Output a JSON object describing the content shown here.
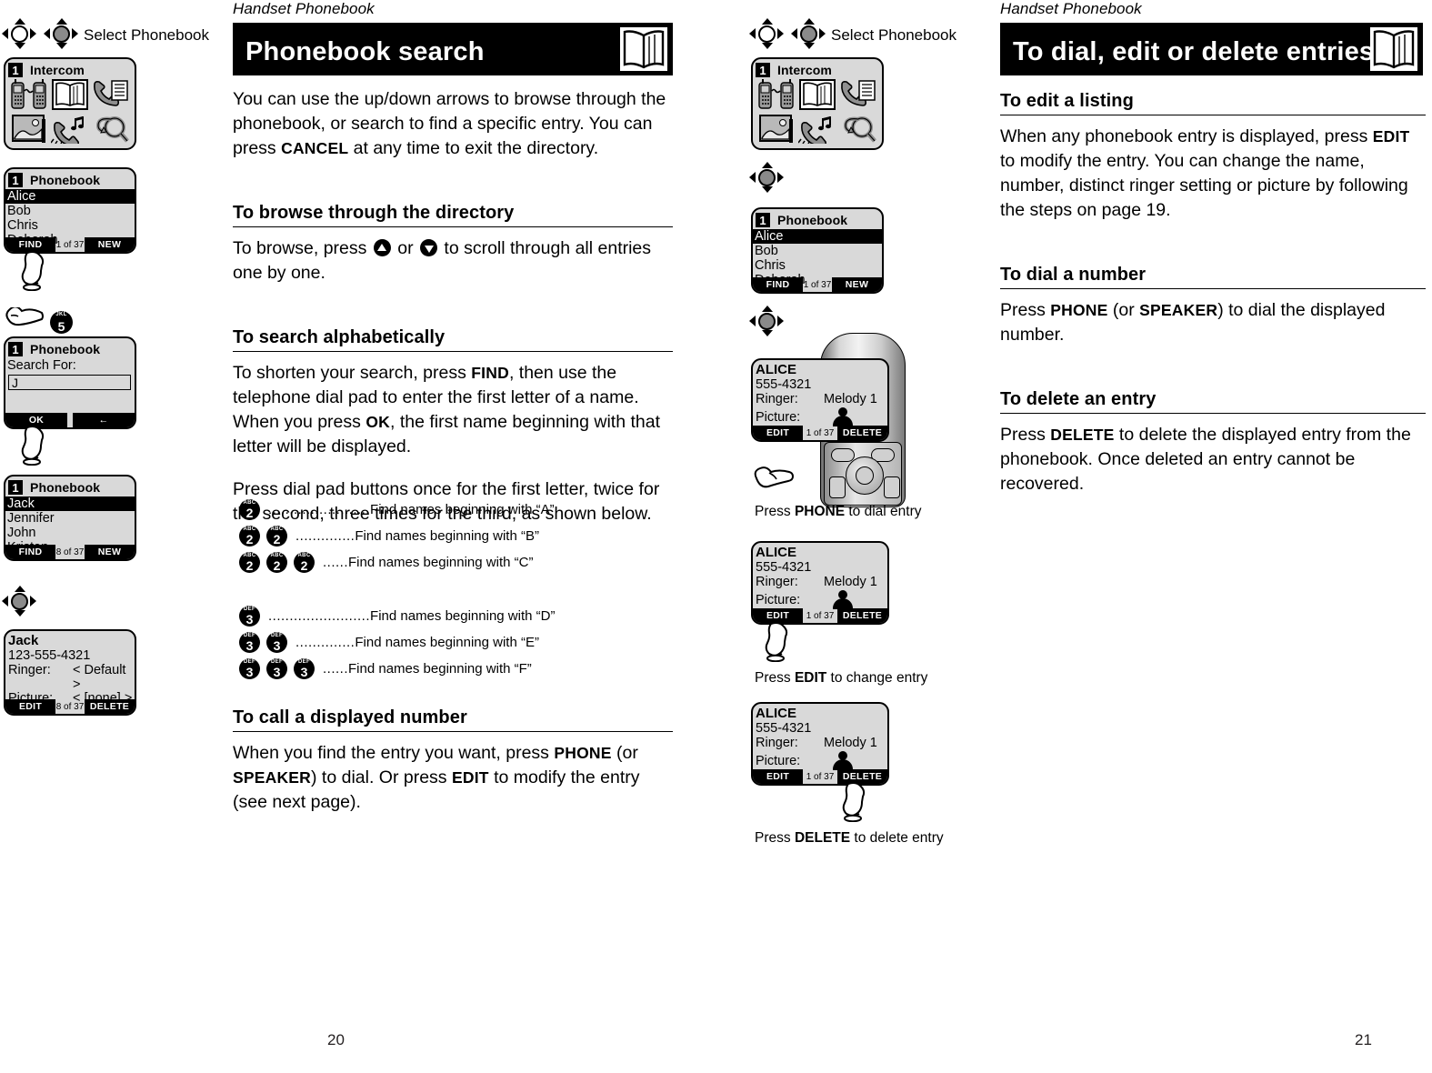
{
  "meta": {
    "left_page_number": "20",
    "right_page_number": "21"
  },
  "left_page": {
    "running_head": "Handset Phonebook",
    "title": "Phonebook search",
    "title_icon": "open-book-icon",
    "intro": {
      "pre1": "You can use the up/down arrows to browse through the phonebook, or search to find a specific entry. You can press ",
      "bold1": "CANCEL",
      "post1": " at any time to exit the directory."
    },
    "section_browse": {
      "heading": "To browse through the directory",
      "pre": "To browse, press ",
      "mid": " or ",
      "post": " to scroll through all entries one by one."
    },
    "section_alpha": {
      "heading": "To search alphabetically",
      "p1_a": "To shorten your search, press ",
      "p1_b": "FIND",
      "p1_c": ", then use the telephone dial pad to enter the first letter of a name. When you press ",
      "p1_d": "OK",
      "p1_e": ", the first name beginning with that letter will be displayed.",
      "p2": "Press dial pad buttons once for the first letter, twice for the second, three times for the third, as shown below."
    },
    "keyrows": [
      {
        "keys": [
          {
            "letters": "ABC",
            "number": "2"
          }
        ],
        "dots": "........................",
        "desc": "Find names beginning with “A”"
      },
      {
        "keys": [
          {
            "letters": "ABC",
            "number": "2"
          },
          {
            "letters": "ABC",
            "number": "2"
          }
        ],
        "dots": "..............",
        "desc": "Find names beginning with “B”"
      },
      {
        "keys": [
          {
            "letters": "ABC",
            "number": "2"
          },
          {
            "letters": "ABC",
            "number": "2"
          },
          {
            "letters": "ABC",
            "number": "2"
          }
        ],
        "dots": "......",
        "desc": "Find names beginning with “C”"
      },
      {
        "keys": [
          {
            "letters": "DEF",
            "number": "3"
          }
        ],
        "dots": "........................",
        "desc": "Find names beginning with “D”"
      },
      {
        "keys": [
          {
            "letters": "DEF",
            "number": "3"
          },
          {
            "letters": "DEF",
            "number": "3"
          }
        ],
        "dots": "..............",
        "desc": "Find names beginning with “E”"
      },
      {
        "keys": [
          {
            "letters": "DEF",
            "number": "3"
          },
          {
            "letters": "DEF",
            "number": "3"
          },
          {
            "letters": "DEF",
            "number": "3"
          }
        ],
        "dots": "......",
        "desc": "Find names beginning with “F”"
      }
    ],
    "section_call": {
      "heading": "To call a displayed number",
      "p_a": "When you find the entry you want, press ",
      "p_b": "PHONE",
      "p_c": " (or ",
      "p_d": "SPEAKER",
      "p_e": ") to dial. Or press ",
      "p_f": "EDIT",
      "p_g": " to modify the entry (see next page)."
    }
  },
  "left_sidebar": {
    "nav_label": "Select Phonebook",
    "screen_intercom": {
      "slot": "1",
      "title": "Intercom",
      "icons": [
        "intercom-handsets-icon",
        "phonebook-book-icon",
        "call-log-icon",
        "picture-frame-icon",
        "ringer-melody-icon",
        "search-magnifier-icon"
      ],
      "selected_icon": "phonebook-book-icon"
    },
    "screen_list_1": {
      "slot": "1",
      "title": "Phonebook",
      "entries": [
        "Alice",
        "Bob",
        "Chris",
        "Deborah"
      ],
      "selected": "Alice",
      "soft_left": "FIND",
      "counter": "1 of 37",
      "soft_right": "NEW"
    },
    "key_five": {
      "letters": "JKL",
      "number": "5"
    },
    "screen_search": {
      "slot": "1",
      "title": "Phonebook",
      "label": "Search For:",
      "value": "J",
      "soft_left": "OK",
      "soft_right": "←"
    },
    "screen_list_2": {
      "slot": "1",
      "title": "Phonebook",
      "entries": [
        "Jack",
        "Jennifer",
        "John",
        "Kristen"
      ],
      "selected": "Jack",
      "soft_left": "FIND",
      "counter": "8 of 37",
      "soft_right": "NEW"
    },
    "screen_detail_jack": {
      "name": "Jack",
      "number": "123-555-4321",
      "ringer_label": "Ringer:",
      "ringer_value": "< Default >",
      "picture_label": "Picture:",
      "picture_value": "< [none] >",
      "soft_left": "EDIT",
      "counter": "8 of 37",
      "soft_right": "DELETE"
    }
  },
  "right_sidebar": {
    "nav_label": "Select Phonebook",
    "screen_intercom": {
      "slot": "1",
      "title": "Intercom",
      "icons": [
        "intercom-handsets-icon",
        "phonebook-book-icon",
        "call-log-icon",
        "picture-frame-icon",
        "ringer-melody-icon",
        "search-magnifier-icon"
      ],
      "selected_icon": "phonebook-book-icon"
    },
    "screen_list": {
      "slot": "1",
      "title": "Phonebook",
      "entries": [
        "Alice",
        "Bob",
        "Chris",
        "Deborah"
      ],
      "selected": "Alice",
      "soft_left": "FIND",
      "counter": "1 of 37",
      "soft_right": "NEW"
    },
    "screen_alice_dial": {
      "name": "ALICE",
      "number": "555-4321",
      "ringer_label": "Ringer:",
      "ringer_value": "Melody 1",
      "picture_label": "Picture:",
      "soft_left": "EDIT",
      "counter": "1 of 37",
      "soft_right": "DELETE"
    },
    "caption_dial_a": "Press ",
    "caption_dial_b": "PHONE",
    "caption_dial_c": " to dial entry",
    "screen_alice_edit": {
      "name": "ALICE",
      "number": "555-4321",
      "ringer_label": "Ringer:",
      "ringer_value": "Melody 1",
      "picture_label": "Picture:",
      "soft_left": "EDIT",
      "counter": "1 of 37",
      "soft_right": "DELETE"
    },
    "caption_edit_a": "Press ",
    "caption_edit_b": "EDIT",
    "caption_edit_c": " to change entry",
    "screen_alice_delete": {
      "name": "ALICE",
      "number": "555-4321",
      "ringer_label": "Ringer:",
      "ringer_value": "Melody 1",
      "picture_label": "Picture:",
      "soft_left": "EDIT",
      "counter": "1 of 37",
      "soft_right": "DELETE"
    },
    "caption_del_a": "Press ",
    "caption_del_b": "DELETE",
    "caption_del_c": " to delete entry"
  },
  "right_page": {
    "running_head": "Handset Phonebook",
    "title": "To dial, edit or delete entries",
    "title_icon": "open-book-icon",
    "section_edit": {
      "heading": "To edit a listing",
      "p_a": "When any phonebook entry is displayed, press ",
      "p_b": "EDIT",
      "p_c": " to modify the entry. You can change the name, number, distinct ringer setting or picture by following the steps on page 19."
    },
    "section_dial": {
      "heading": "To dial a number",
      "p_a": "Press ",
      "p_b": "PHONE",
      "p_c": " (or ",
      "p_d": "SPEAKER",
      "p_e": ") to dial the displayed number."
    },
    "section_delete": {
      "heading": "To delete an entry",
      "p_a": "Press ",
      "p_b": "DELETE",
      "p_c": " to delete the displayed entry from the phonebook. Once deleted an entry cannot be recovered."
    }
  }
}
